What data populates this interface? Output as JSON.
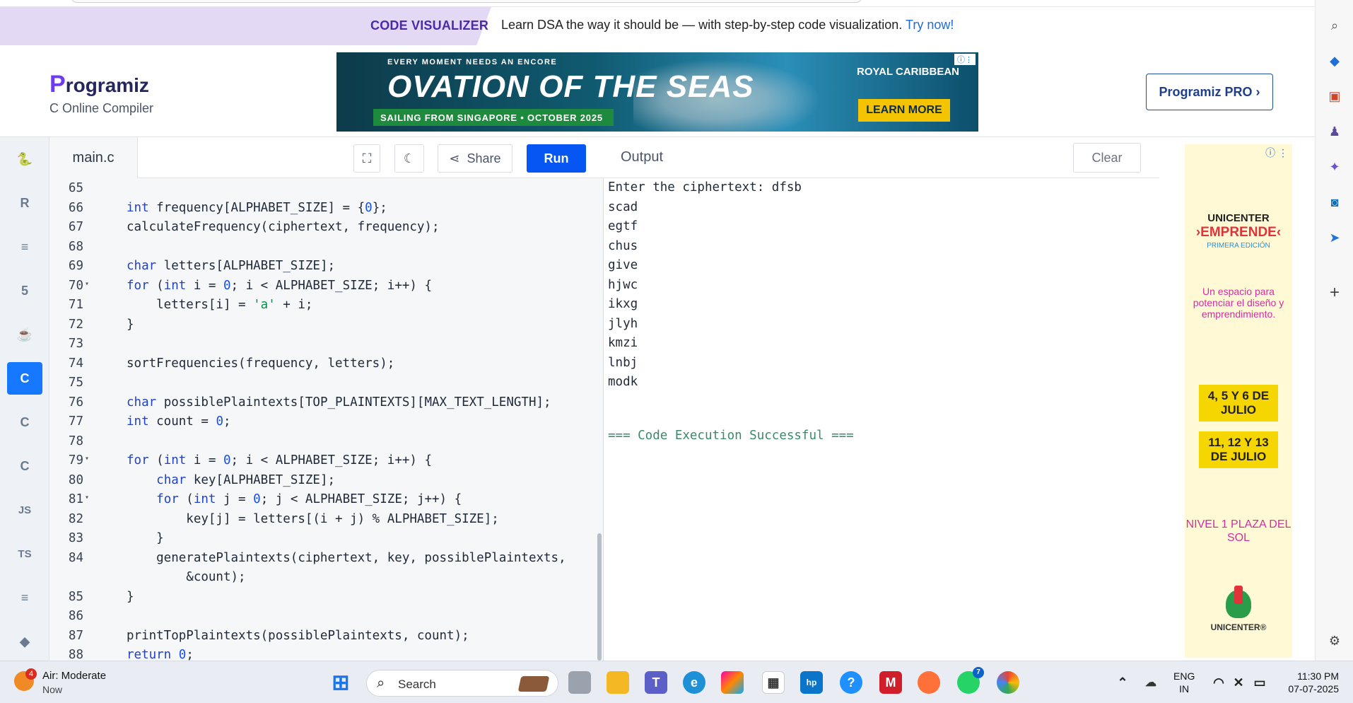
{
  "promo": {
    "tag": "CODE VISUALIZER",
    "message": "Learn DSA the way it should be — with step-by-step code visualization.",
    "link": "Try now!"
  },
  "header": {
    "logo": "rogramiz",
    "logo_letter": "P",
    "subtitle": "C Online Compiler",
    "pro_button": "Programiz PRO ›"
  },
  "ad_banner": {
    "tagline": "EVERY MOMENT NEEDS AN ENCORE",
    "title": "OVATION OF THE SEAS",
    "strip": "SAILING FROM SINGAPORE • OCTOBER 2025",
    "brand": "ROYAL CARIBBEAN",
    "cta": "LEARN MORE",
    "info_icon": "info-icon"
  },
  "languages": [
    {
      "name": "python",
      "label": "🐍"
    },
    {
      "name": "r",
      "label": "R"
    },
    {
      "name": "sql",
      "label": "≡"
    },
    {
      "name": "html",
      "label": "5"
    },
    {
      "name": "java",
      "label": "☕"
    },
    {
      "name": "c",
      "label": "C"
    },
    {
      "name": "cpp",
      "label": "C"
    },
    {
      "name": "csharp",
      "label": "C"
    },
    {
      "name": "js",
      "label": "JS"
    },
    {
      "name": "ts",
      "label": "TS"
    },
    {
      "name": "go",
      "label": "≡"
    },
    {
      "name": "swift",
      "label": "◆"
    }
  ],
  "editor": {
    "file_name": "main.c",
    "share_label": "Share",
    "run_label": "Run",
    "lines": [
      {
        "n": "65",
        "code": ""
      },
      {
        "n": "66",
        "code": "int frequency[ALPHABET_SIZE] = {0};"
      },
      {
        "n": "67",
        "code": "calculateFrequency(ciphertext, frequency);"
      },
      {
        "n": "68",
        "code": ""
      },
      {
        "n": "69",
        "code": "char letters[ALPHABET_SIZE];"
      },
      {
        "n": "70",
        "code": "for (int i = 0; i < ALPHABET_SIZE; i++) {",
        "fold": true
      },
      {
        "n": "71",
        "code": "    letters[i] = 'a' + i;"
      },
      {
        "n": "72",
        "code": "}"
      },
      {
        "n": "73",
        "code": ""
      },
      {
        "n": "74",
        "code": "sortFrequencies(frequency, letters);"
      },
      {
        "n": "75",
        "code": ""
      },
      {
        "n": "76",
        "code": "char possiblePlaintexts[TOP_PLAINTEXTS][MAX_TEXT_LENGTH];"
      },
      {
        "n": "77",
        "code": "int count = 0;"
      },
      {
        "n": "78",
        "code": ""
      },
      {
        "n": "79",
        "code": "for (int i = 0; i < ALPHABET_SIZE; i++) {",
        "fold": true
      },
      {
        "n": "80",
        "code": "    char key[ALPHABET_SIZE];"
      },
      {
        "n": "81",
        "code": "    for (int j = 0; j < ALPHABET_SIZE; j++) {",
        "fold": true
      },
      {
        "n": "82",
        "code": "        key[j] = letters[(i + j) % ALPHABET_SIZE];"
      },
      {
        "n": "83",
        "code": "    }"
      },
      {
        "n": "84",
        "code": "    generatePlaintexts(ciphertext, key, possiblePlaintexts,"
      },
      {
        "n": "",
        "code": "        &count);"
      },
      {
        "n": "85",
        "code": "}"
      },
      {
        "n": "86",
        "code": ""
      },
      {
        "n": "87",
        "code": "printTopPlaintexts(possiblePlaintexts, count);"
      },
      {
        "n": "88",
        "code": "return 0;"
      }
    ]
  },
  "output": {
    "title": "Output",
    "clear_label": "Clear",
    "lines": [
      "Enter the ciphertext: dfsb",
      "scad",
      "egtf",
      "chus",
      "give",
      "hjwc",
      "ikxg",
      "jlyh",
      "kmzi",
      "lnbj",
      "modk"
    ],
    "status": "=== Code Execution Successful ==="
  },
  "side_ad": {
    "brand": "UNICENTER",
    "title": "›EMPRENDE‹",
    "edition": "PRIMERA EDICIÓN",
    "description": "Un espacio para potenciar el diseño y emprendimiento.",
    "date1": "4, 5 Y 6 DE JULIO",
    "date2": "11, 12 Y 13 DE JULIO",
    "location": "NIVEL 1 PLAZA DEL SOL",
    "logo_text": "UNICENTER®"
  },
  "taskbar": {
    "weather_title": "Air: Moderate",
    "weather_sub": "Now",
    "weather_badge": "4",
    "search_placeholder": "Search",
    "whatsapp_badge": "7",
    "lang_top": "ENG",
    "lang_bottom": "IN",
    "time": "11:30 PM",
    "date": "07-07-2025"
  },
  "colors": {
    "run_button": "#0556f3",
    "active_language": "#1677ff",
    "promo_bg": "#e4d9f5",
    "success_text": "#3a8a6a"
  }
}
